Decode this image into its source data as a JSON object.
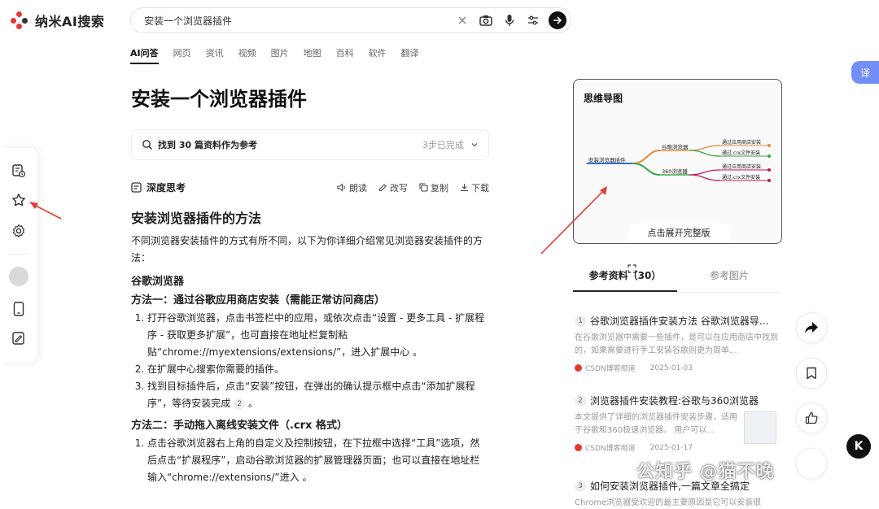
{
  "app": {
    "name": "纳米AI搜索"
  },
  "search": {
    "query": "安装一个浏览器插件"
  },
  "tabs": [
    {
      "label": "AI问答",
      "active": true
    },
    {
      "label": "网页"
    },
    {
      "label": "资讯"
    },
    {
      "label": "视频"
    },
    {
      "label": "图片"
    },
    {
      "label": "地图"
    },
    {
      "label": "百科"
    },
    {
      "label": "软件"
    },
    {
      "label": "翻译"
    }
  ],
  "translate_badge": "译",
  "answer": {
    "title": "安装一个浏览器插件",
    "sources_label": "找到 30 篇资料作为参考",
    "steps_done": "3步已完成",
    "deep_think": "深度思考",
    "actions": {
      "read": "朗读",
      "rewrite": "改写",
      "copy": "复制",
      "download": "下载"
    },
    "heading": "安装浏览器插件的方法",
    "intro": "不同浏览器安装插件的方式有所不同，以下为你详细介绍常见浏览器安装插件的方法：",
    "section1": "谷歌浏览器",
    "method1": "方法一：通过谷歌应用商店安装（需能正常访问商店）",
    "method1_steps": [
      "打开谷歌浏览器，点击书签栏中的应用，或依次点击“设置 - 更多工具 - 扩展程序 - 获取更多扩展”，也可直接在地址栏复制粘贴“chrome://myextensions/extensions/”，进入扩展中心 。",
      "在扩展中心搜索你需要的插件。",
      "找到目标插件后，点击“安装”按钮，在弹出的确认提示框中点击“添加扩展程序”，等待安装完成"
    ],
    "method1_cite": "2",
    "method2": "方法二：手动拖入离线安装文件（.crx 格式）",
    "method2_steps": [
      "点击谷歌浏览器右上角的自定义及控制按钮，在下拉框中选择“工具”选项，然后点击“扩展程序”，启动谷歌浏览器的扩展管理器页面；也可以直接在地址栏输入“chrome://extensions/”进入 。"
    ]
  },
  "mindmap": {
    "title": "思维导图",
    "root": "安装浏览器插件",
    "branches": [
      {
        "label": "谷歌浏览器",
        "children": [
          "通过应用商店安装",
          "通过.crx文件安装"
        ]
      },
      {
        "label": "360浏览器",
        "children": [
          "通过应用商店安装",
          "通过.crx文件安装"
        ]
      }
    ],
    "expand_label": "点击展开完整版",
    "colors": {
      "root": "#2e6fd6",
      "branch1": "#e8893a",
      "branch2": "#3fa34d",
      "leaf_pink": "#c2185b"
    }
  },
  "references": {
    "tabs": [
      "参考资料（30）",
      "参考图片"
    ],
    "items": [
      {
        "num": "1",
        "title": "谷歌浏览器插件安装方法 谷歌浏览器导...",
        "desc": "在谷歌浏览器中需要一些插件，是可以在应用商店中找到的，如果需要进行手工安装谷歌则更为简单...",
        "source": "CSDN博客频道",
        "date": "2025-01-03"
      },
      {
        "num": "2",
        "title": "浏览器插件安装教程:谷歌与360浏览器",
        "desc": "本文提供了详细的浏览器插件安装步骤，适用于谷歌和360极速浏览器。 用户可以...",
        "source": "CSDN博客频道",
        "date": "2025-01-17"
      },
      {
        "num": "3",
        "title": "如何安装浏览器插件,一篇文章全搞定",
        "desc": "Chrome浏览器受欢迎的最主要原因是它可以安装很",
        "source": "",
        "date": ""
      }
    ]
  },
  "watermark": "公知乎 @猫不晚",
  "k_badge": "K"
}
